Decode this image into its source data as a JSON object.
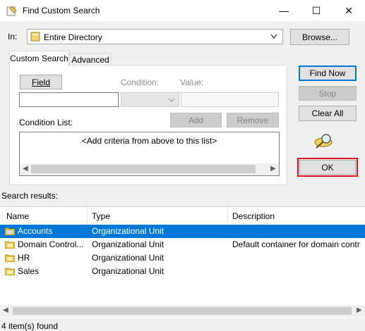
{
  "window": {
    "title": "Find Custom Search",
    "minimize_glyph": "—",
    "maximize_glyph": "☐",
    "close_glyph": "✕"
  },
  "in_row": {
    "label": "In:",
    "value": "Entire Directory",
    "browse_label": "Browse..."
  },
  "tabs": [
    {
      "label": "Custom Search",
      "selected": true
    },
    {
      "label": "Advanced",
      "selected": false
    }
  ],
  "criteria": {
    "field_button": "Field",
    "condition_label": "Condition:",
    "value_label": "Value:",
    "condition_list_label": "Condition List:",
    "add_button": "Add",
    "remove_button": "Remove",
    "list_placeholder": "<Add criteria from above to this list>"
  },
  "actions": {
    "find_now": "Find Now",
    "stop": "Stop",
    "clear_all": "Clear All",
    "ok": "OK",
    "search_icon": "magnifier-icon"
  },
  "results": {
    "label": "Search results:",
    "columns": [
      "Name",
      "Type",
      "Description"
    ],
    "rows": [
      {
        "name": "Accounts",
        "type": "Organizational Unit",
        "description": "",
        "selected": true
      },
      {
        "name": "Domain Control...",
        "type": "Organizational Unit",
        "description": "Default container for domain contr",
        "selected": false
      },
      {
        "name": "HR",
        "type": "Organizational Unit",
        "description": "",
        "selected": false
      },
      {
        "name": "Sales",
        "type": "Organizational Unit",
        "description": "",
        "selected": false
      }
    ],
    "status": "4 item(s) found"
  },
  "colors": {
    "selection": "#0078d7",
    "ok_highlight": "#e0141e"
  }
}
